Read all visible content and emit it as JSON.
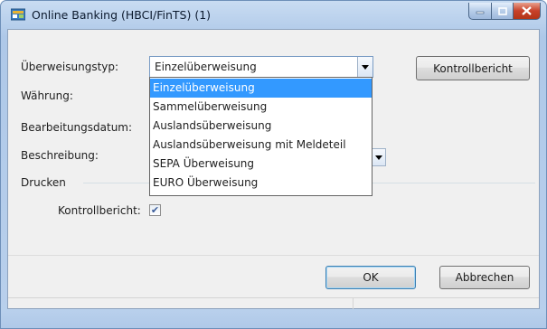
{
  "window": {
    "title": "Online Banking (HBCI/FinTS) (1)"
  },
  "form": {
    "transfer_type_label": "Überweisungstyp:",
    "transfer_type_value": "Einzelüberweisung",
    "currency_label": "Währung:",
    "processing_date_label": "Bearbeitungsdatum:",
    "description_label": "Beschreibung:",
    "print_group_label": "Drucken",
    "control_report_label": "Kontrollbericht:",
    "control_report_checked": true
  },
  "dropdown": {
    "options": [
      "Einzelüberweisung",
      "Sammelüberweisung",
      "Auslandsüberweisung",
      "Auslandsüberweisung mit Meldeteil",
      "SEPA Überweisung",
      "EURO Überweisung"
    ],
    "selected_index": 0
  },
  "buttons": {
    "control_report": "Kontrollbericht",
    "ok": "OK",
    "cancel": "Abbrechen"
  },
  "colors": {
    "selection": "#3399ff",
    "close_button": "#c7412a",
    "title_bar": "#aec8e8"
  },
  "icons": {
    "app": "app-icon",
    "minimize": "minimize-icon",
    "maximize": "maximize-icon",
    "close": "close-icon",
    "dropdown_arrow": "chevron-down-icon",
    "checkmark": "checkmark-icon"
  }
}
